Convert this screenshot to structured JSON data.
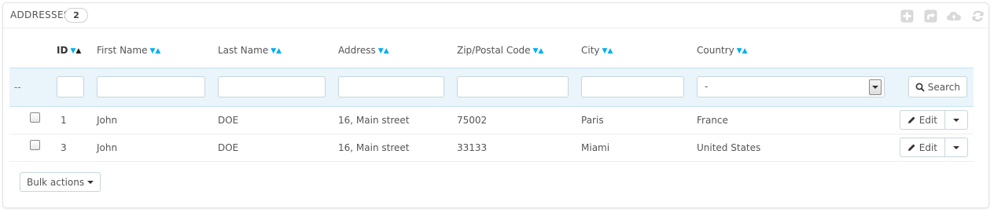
{
  "panel": {
    "title": "Addresses",
    "count": "2",
    "toolbar": [
      {
        "icon": "plus-square-icon",
        "name": "add-new-button"
      },
      {
        "icon": "export-icon",
        "name": "export-button"
      },
      {
        "icon": "cloud-upload-icon",
        "name": "import-button"
      },
      {
        "icon": "refresh-icon",
        "name": "refresh-button"
      }
    ]
  },
  "columns": {
    "id": "ID",
    "first_name": "First Name",
    "last_name": "Last Name",
    "address": "Address",
    "zip": "Zip/Postal Code",
    "city": "City",
    "country": "Country"
  },
  "sort": {
    "down": "▼",
    "up": "▲"
  },
  "filter": {
    "dashes": "--",
    "country_selected": "-",
    "search_label": "Search"
  },
  "rows": [
    {
      "id": "1",
      "first_name": "John",
      "last_name": "DOE",
      "address": "16, Main street",
      "zip": "75002",
      "city": "Paris",
      "country": "France",
      "edit": "Edit"
    },
    {
      "id": "3",
      "first_name": "John",
      "last_name": "DOE",
      "address": "16, Main street",
      "zip": "33133",
      "city": "Miami",
      "country": "United States",
      "edit": "Edit"
    }
  ],
  "bulk_actions_label": "Bulk actions",
  "colors": {
    "accent": "#00aff0",
    "filter_bg": "#e9f4fb",
    "border": "#c7d6db"
  }
}
